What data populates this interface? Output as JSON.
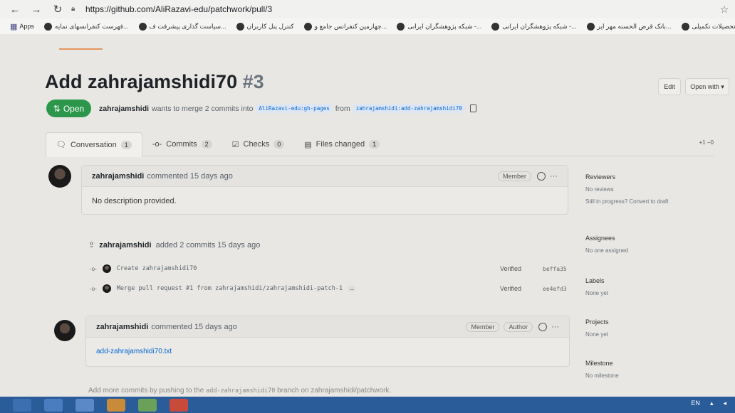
{
  "browser": {
    "url": "https://github.com/AliRazavi-edu/patchwork/pull/3",
    "bookmarks": [
      {
        "label": "Apps"
      },
      {
        "label": "فهرست کنفرانسهای نمایه..."
      },
      {
        "label": "سیاست گذاری پیشرفت ف..."
      },
      {
        "label": "کنترل پنل کاربران"
      },
      {
        "label": "چهارمین کنفرانس جامع و..."
      },
      {
        "label": "شبکه پژوهشگران ایرانی -..."
      },
      {
        "label": "شبکه پژوهشگران ایرانی -..."
      },
      {
        "label": "بانک قرض الحسنه مهر ایر..."
      },
      {
        "label": "دفتر تحصیلات تکمیلی"
      }
    ]
  },
  "pr": {
    "title": "Add zahrajamshidi70",
    "number": "#3",
    "edit_label": "Edit",
    "open_with_label": "Open with",
    "state": "Open",
    "author": "zahrajamshidi",
    "merge_text": "wants to merge 2 commits into",
    "base_branch": "AliRazavi-edu:gh-pages",
    "from_text": "from",
    "head_branch": "zahrajamshidi:add-zahrajamshidi70"
  },
  "tabs": [
    {
      "label": "Conversation",
      "count": "1"
    },
    {
      "label": "Commits",
      "count": "2"
    },
    {
      "label": "Checks",
      "count": "0"
    },
    {
      "label": "Files changed",
      "count": "1"
    }
  ],
  "diffstat": "+1 −0",
  "comments": [
    {
      "author": "zahrajamshidi",
      "action": "commented 15 days ago",
      "role": "Member",
      "body": "No description provided."
    },
    {
      "author": "zahrajamshidi",
      "action": "commented 15 days ago",
      "role": "Member",
      "role2": "Author",
      "body": "add-zahrajamshidi70.txt"
    }
  ],
  "commit_event": {
    "author": "zahrajamshidi",
    "text": "added 2 commits 15 days ago"
  },
  "commits": [
    {
      "message": "Create zahrajamshidi70",
      "verified": "Verified",
      "sha": "beffa35"
    },
    {
      "message": "Merge pull request #1 from zahrajamshidi/zahrajamshidi-patch-1",
      "verified": "Verified",
      "sha": "ee4efd3"
    }
  ],
  "sidebar": {
    "reviewers_title": "Reviewers",
    "reviewers_value": "No reviews",
    "draft_hint": "Still in progress? Convert to draft",
    "assignees_title": "Assignees",
    "assignees_value": "No one assigned",
    "labels_title": "Labels",
    "labels_value": "None yet",
    "projects_title": "Projects",
    "projects_value": "None yet",
    "milestone_title": "Milestone",
    "milestone_value": "No milestone"
  },
  "footer": {
    "prefix": "Add more commits by pushing to the",
    "branch": "add-zahrajamshidi70",
    "middle": "branch on",
    "repo": "zahrajamshidi/patchwork."
  },
  "tray": {
    "lang": "EN"
  }
}
